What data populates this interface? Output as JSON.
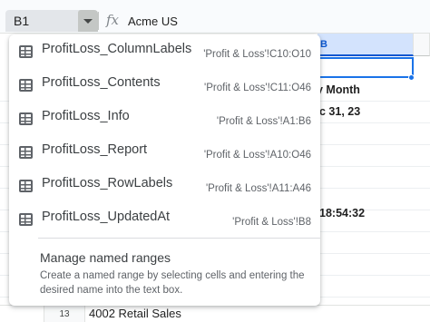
{
  "name_box": {
    "value": "B1"
  },
  "formula_bar": {
    "fx_label": "fx",
    "value": "Acme US"
  },
  "grid": {
    "column_header_selected": "B",
    "visible_cells": [
      "y Month",
      "c 31, 23",
      "18:54:32"
    ],
    "row": {
      "number": "13",
      "value": "4002 Retail Sales"
    }
  },
  "named_ranges": [
    {
      "name": "ProfitLoss_ColumnLabels",
      "reference": "'Profit & Loss'!C10:O10",
      "icon": "table-icon"
    },
    {
      "name": "ProfitLoss_Contents",
      "reference": "'Profit & Loss'!C11:O46",
      "icon": "table-icon"
    },
    {
      "name": "ProfitLoss_Info",
      "reference": "'Profit & Loss'!A1:B6",
      "icon": "table-icon"
    },
    {
      "name": "ProfitLoss_Report",
      "reference": "'Profit & Loss'!A10:O46",
      "icon": "table-icon"
    },
    {
      "name": "ProfitLoss_RowLabels",
      "reference": "'Profit & Loss'!A11:A46",
      "icon": "table-icon"
    },
    {
      "name": "ProfitLoss_UpdatedAt",
      "reference": "'Profit & Loss'!B8",
      "icon": "table-icon"
    }
  ],
  "manage": {
    "title": "Manage named ranges",
    "description": "Create a named range by selecting cells and entering the desired name into the text box."
  },
  "colors": {
    "selection": "#1a73e8",
    "selected_header_bg": "#d3e3fd",
    "dropdown_text": "#3c4043"
  }
}
